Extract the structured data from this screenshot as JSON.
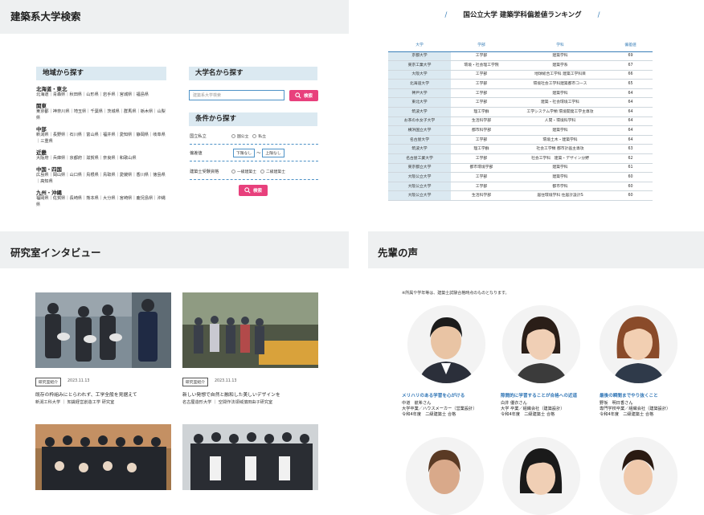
{
  "search": {
    "title": "建築系大学検索",
    "region_label": "地域から探す",
    "regions": [
      {
        "name": "北海道・東北",
        "prefs": "北海道｜青森県｜秋田県｜山形県｜岩手県｜宮城県｜福島県"
      },
      {
        "name": "関東",
        "prefs": "東京都｜神奈川県｜埼玉県｜千葉県｜茨城県｜群馬県｜栃木県｜山梨県"
      },
      {
        "name": "中部",
        "prefs": "新潟県｜長野県｜石川県｜富山県｜福井県｜愛知県｜静岡県｜岐阜県｜三重県"
      },
      {
        "name": "近畿",
        "prefs": "大阪府｜兵庫県｜京都府｜滋賀県｜奈良県｜和歌山県"
      },
      {
        "name": "中国・四国",
        "prefs": "広島県｜岡山県｜山口県｜鳥根県｜鳥取県｜愛媛県｜香川県｜徳島県｜高知県"
      },
      {
        "name": "九州・沖縄",
        "prefs": "福岡県｜佐賀県｜長崎県｜熊本県｜大分県｜宮崎県｜鹿児島県｜沖縄県"
      }
    ],
    "name_label": "大学名から探す",
    "name_placeholder": "建築系大学検索",
    "search_button": "検索",
    "cond_label": "条件から探す",
    "cond": {
      "row1_label": "国立私立",
      "row1_opt1": "国公立",
      "row1_opt2": "私立",
      "row2_label": "偏差値",
      "row2_min": "下限なし",
      "row2_sep": "〜",
      "row2_max": "上限なし",
      "row3_label": "建築士受験資格",
      "row3_opt1": "一級建築士",
      "row3_opt2": "二級建築士"
    },
    "cond_button": "検索"
  },
  "ranking": {
    "title": "国公立大学 建築学科偏差値ランキング",
    "slash": "/",
    "headers": [
      "大学",
      "学部",
      "学科",
      "偏差値"
    ],
    "rows": [
      [
        "京都大学",
        "工学部",
        "建築学科",
        "69"
      ],
      [
        "東京工業大学",
        "環境・社会理工学院",
        "建築学系",
        "67"
      ],
      [
        "大阪大学",
        "工学部",
        "地球総合工学科 建築工学科目",
        "66"
      ],
      [
        "北海道大学",
        "工学部",
        "環境社会工学科建築都市コース",
        "65"
      ],
      [
        "神戸大学",
        "工学部",
        "建築学科",
        "64"
      ],
      [
        "東北大学",
        "工学部",
        "建築・社会環境工学科",
        "64"
      ],
      [
        "筑波大学",
        "理工学群",
        "工学システム学類 環境開発工学主専攻",
        "64"
      ],
      [
        "お茶の水女子大学",
        "生活科学部",
        "人間・環境科学科",
        "64"
      ],
      [
        "横浜国立大学",
        "都市科学部",
        "建築学科",
        "64"
      ],
      [
        "名古屋大学",
        "工学部",
        "環境土木・建築学科",
        "64"
      ],
      [
        "筑波大学",
        "理工学群",
        "社会工学類 都市計画主専攻",
        "63"
      ],
      [
        "名古屋工業大学",
        "工学部",
        "社会工学科　建築・デザイン分野",
        "62"
      ],
      [
        "東京都立大学",
        "都市環境学部",
        "建築学科",
        "61"
      ],
      [
        "大阪公立大学",
        "工学部",
        "建築学科",
        "60"
      ],
      [
        "大阪公立大学",
        "工学部",
        "都市学科",
        "60"
      ],
      [
        "大阪公立大学",
        "生活科学部",
        "居住環境学科 住居計設計S",
        "60"
      ]
    ]
  },
  "interview": {
    "title": "研究室インタビュー",
    "cards": [
      {
        "tag": "研究室紹介",
        "date": "2023.11.13",
        "title": "既存の枠組みにとらわれず、工学全般を見据えて",
        "sub": "新潟工科大学 ｜ 知識経営創造工学 研究室"
      },
      {
        "tag": "研究室紹介",
        "date": "2023.11.13",
        "title": "新しい発想で自然と融和した美しいデザインを",
        "sub": "名古屋造形大学 ｜ 空間作法領域濱田由子研究室"
      }
    ]
  },
  "voices": {
    "title": "先輩の声",
    "note": "※所属や学年等は、建築士試験合格時点のものとなります。",
    "items": [
      {
        "head": "メリハリのある学習を心がける",
        "name": "中道　航希さん",
        "line2": "大学卒業／ハウスメーカー（営業設計）",
        "line3": "令和4年度　二級建築士 合格"
      },
      {
        "head": "隙間的に学習することが合格への近道",
        "name": "白井 優衣さん",
        "line2": "大学 卒業／組織会社（建築設計）",
        "line3": "令和4年度　二級建築士 合格"
      },
      {
        "head": "最後の瞬間までやり抜くこと",
        "name": "野坂　明日香さん",
        "line2": "専門学校卒業／組織会社（建築設計）",
        "line3": "令和4年度　二級建築士 合格"
      }
    ]
  }
}
